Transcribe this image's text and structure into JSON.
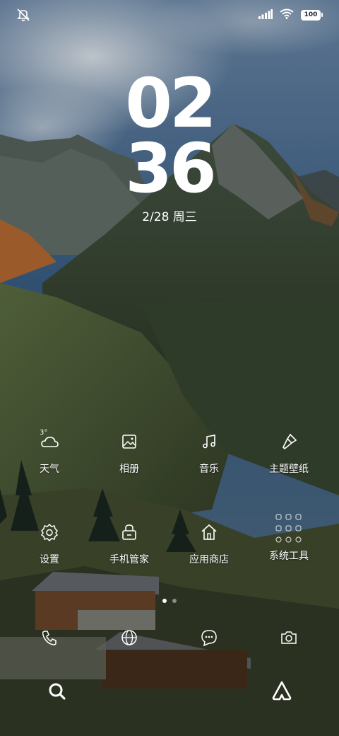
{
  "status": {
    "battery": "100",
    "left_icon": "mute-icon",
    "right_icons": [
      "signal-icon",
      "wifi-icon",
      "battery-icon"
    ]
  },
  "clock": {
    "hours": "02",
    "minutes": "36"
  },
  "date": "2/28 周三",
  "weather": {
    "temperature": "3°"
  },
  "apps_row1": [
    {
      "label": "天气",
      "icon": "weather-icon"
    },
    {
      "label": "相册",
      "icon": "gallery-icon"
    },
    {
      "label": "音乐",
      "icon": "music-icon"
    },
    {
      "label": "主题壁纸",
      "icon": "theme-icon"
    }
  ],
  "apps_row2": [
    {
      "label": "设置",
      "icon": "gear-icon"
    },
    {
      "label": "手机管家",
      "icon": "lock-icon"
    },
    {
      "label": "应用商店",
      "icon": "store-icon"
    },
    {
      "label": "系统工具",
      "icon": "folder-icon"
    }
  ],
  "page_indicator": {
    "current": 1,
    "total": 2
  },
  "dock": [
    "phone-icon",
    "browser-icon",
    "messages-icon",
    "camera-icon"
  ],
  "bottom": [
    "search-icon",
    "assistant-icon"
  ]
}
